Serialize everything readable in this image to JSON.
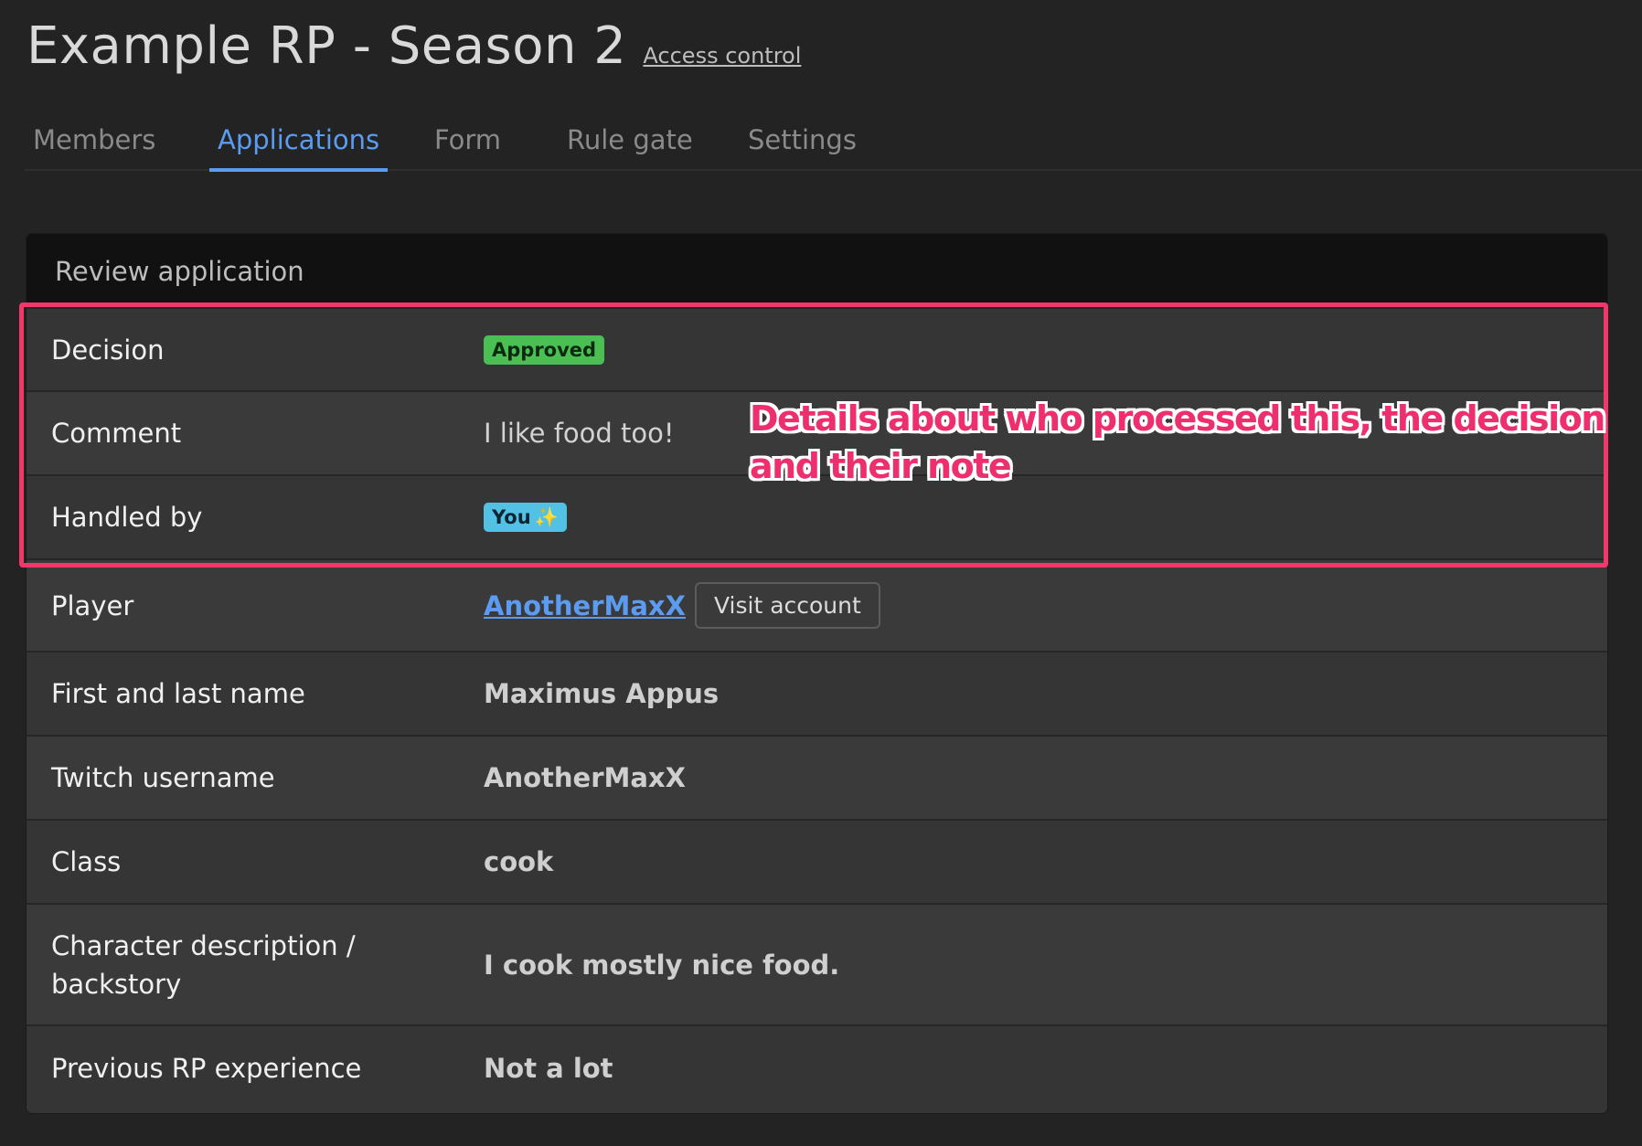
{
  "header": {
    "title": "Example RP - Season 2",
    "access_link": "Access control"
  },
  "tabs": [
    {
      "label": "Members",
      "active": false
    },
    {
      "label": "Applications",
      "active": true
    },
    {
      "label": "Form",
      "active": false
    },
    {
      "label": "Rule gate",
      "active": false
    },
    {
      "label": "Settings",
      "active": false
    }
  ],
  "review": {
    "title": "Review application",
    "rows": {
      "decision": {
        "label": "Decision",
        "value": "Approved"
      },
      "comment": {
        "label": "Comment",
        "value": "I like food too!"
      },
      "handled_by": {
        "label": "Handled by",
        "value": "You",
        "emoji": "✨"
      },
      "player": {
        "label": "Player",
        "value": "AnotherMaxX",
        "button": "Visit account"
      },
      "name": {
        "label": "First and last name",
        "value": "Maximus Appus"
      },
      "twitch": {
        "label": "Twitch username",
        "value": "AnotherMaxX"
      },
      "class": {
        "label": "Class",
        "value": "cook"
      },
      "backstory": {
        "label_line1": "Character description /",
        "label_line2": "backstory",
        "value": "I cook mostly nice food."
      },
      "experience": {
        "label": "Previous RP experience",
        "value": "Not a lot"
      }
    }
  },
  "annotation": {
    "line1": "Details about who processed this, the decision",
    "line2": "and their note",
    "color": "#ee2f6d"
  },
  "colors": {
    "accent": "#5b9cf0",
    "approved": "#4ac054",
    "you_badge": "#53c1e4",
    "highlight": "#f2386a"
  }
}
